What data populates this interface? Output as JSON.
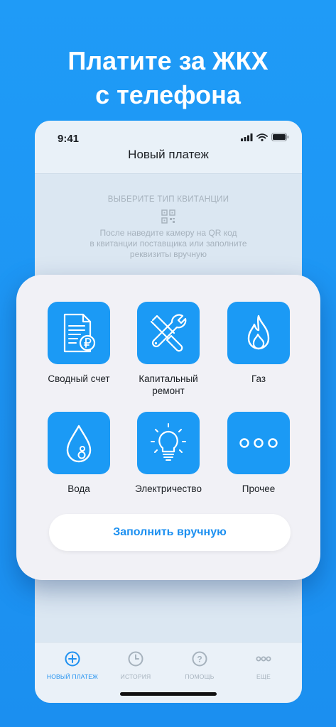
{
  "headline": {
    "line1": "Платите за ЖКХ",
    "line2": "с телефона"
  },
  "status_bar": {
    "time": "9:41"
  },
  "screen": {
    "title": "Новый платеж",
    "hint_title": "ВЫБЕРИТЕ ТИП КВИТАНЦИИ",
    "hint_line1": "После наведите камеру на QR код",
    "hint_line2": "в квитанции поставщика или заполните",
    "hint_line3": "реквизиты вручную"
  },
  "categories": [
    {
      "label": "Сводный счет",
      "icon": "invoice-ruble-icon"
    },
    {
      "label_line1": "Капитальный",
      "label_line2": "ремонт",
      "icon": "wrench-screwdriver-icon"
    },
    {
      "label": "Газ",
      "icon": "flame-icon"
    },
    {
      "label": "Вода",
      "icon": "water-drop-icon"
    },
    {
      "label": "Электричество",
      "icon": "light-bulb-icon"
    },
    {
      "label": "Прочее",
      "icon": "more-dots-icon"
    }
  ],
  "fill_manually_label": "Заполнить вручную",
  "tabs": [
    {
      "label": "НОВЫЙ ПЛАТЕЖ",
      "icon": "plus-circle-icon",
      "active": true
    },
    {
      "label": "ИСТОРИЯ",
      "icon": "clock-icon",
      "active": false
    },
    {
      "label": "ПОМОЩЬ",
      "icon": "help-circle-icon",
      "active": false
    },
    {
      "label": "ЕЩЕ",
      "icon": "more-icon",
      "active": false
    }
  ],
  "colors": {
    "accent": "#1b9af5",
    "background": "#1f9bf7",
    "card": "#f1f1f6",
    "inactive": "#a6b2bd"
  }
}
